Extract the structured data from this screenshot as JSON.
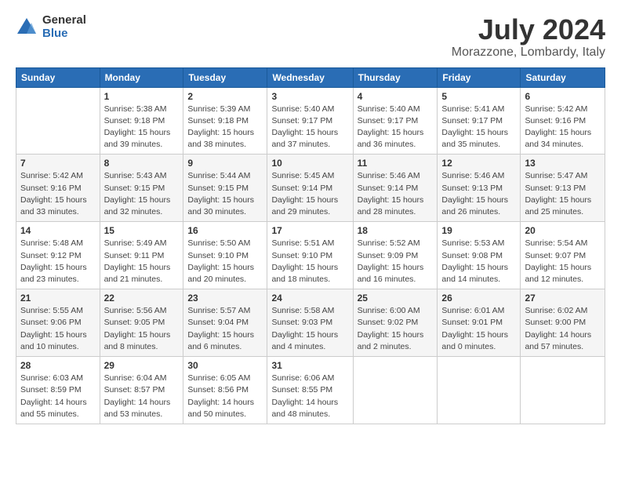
{
  "logo": {
    "general": "General",
    "blue": "Blue"
  },
  "title": "July 2024",
  "subtitle": "Morazzone, Lombardy, Italy",
  "headers": [
    "Sunday",
    "Monday",
    "Tuesday",
    "Wednesday",
    "Thursday",
    "Friday",
    "Saturday"
  ],
  "weeks": [
    [
      {
        "day": "",
        "info": ""
      },
      {
        "day": "1",
        "info": "Sunrise: 5:38 AM\nSunset: 9:18 PM\nDaylight: 15 hours\nand 39 minutes."
      },
      {
        "day": "2",
        "info": "Sunrise: 5:39 AM\nSunset: 9:18 PM\nDaylight: 15 hours\nand 38 minutes."
      },
      {
        "day": "3",
        "info": "Sunrise: 5:40 AM\nSunset: 9:17 PM\nDaylight: 15 hours\nand 37 minutes."
      },
      {
        "day": "4",
        "info": "Sunrise: 5:40 AM\nSunset: 9:17 PM\nDaylight: 15 hours\nand 36 minutes."
      },
      {
        "day": "5",
        "info": "Sunrise: 5:41 AM\nSunset: 9:17 PM\nDaylight: 15 hours\nand 35 minutes."
      },
      {
        "day": "6",
        "info": "Sunrise: 5:42 AM\nSunset: 9:16 PM\nDaylight: 15 hours\nand 34 minutes."
      }
    ],
    [
      {
        "day": "7",
        "info": "Sunrise: 5:42 AM\nSunset: 9:16 PM\nDaylight: 15 hours\nand 33 minutes."
      },
      {
        "day": "8",
        "info": "Sunrise: 5:43 AM\nSunset: 9:15 PM\nDaylight: 15 hours\nand 32 minutes."
      },
      {
        "day": "9",
        "info": "Sunrise: 5:44 AM\nSunset: 9:15 PM\nDaylight: 15 hours\nand 30 minutes."
      },
      {
        "day": "10",
        "info": "Sunrise: 5:45 AM\nSunset: 9:14 PM\nDaylight: 15 hours\nand 29 minutes."
      },
      {
        "day": "11",
        "info": "Sunrise: 5:46 AM\nSunset: 9:14 PM\nDaylight: 15 hours\nand 28 minutes."
      },
      {
        "day": "12",
        "info": "Sunrise: 5:46 AM\nSunset: 9:13 PM\nDaylight: 15 hours\nand 26 minutes."
      },
      {
        "day": "13",
        "info": "Sunrise: 5:47 AM\nSunset: 9:13 PM\nDaylight: 15 hours\nand 25 minutes."
      }
    ],
    [
      {
        "day": "14",
        "info": "Sunrise: 5:48 AM\nSunset: 9:12 PM\nDaylight: 15 hours\nand 23 minutes."
      },
      {
        "day": "15",
        "info": "Sunrise: 5:49 AM\nSunset: 9:11 PM\nDaylight: 15 hours\nand 21 minutes."
      },
      {
        "day": "16",
        "info": "Sunrise: 5:50 AM\nSunset: 9:10 PM\nDaylight: 15 hours\nand 20 minutes."
      },
      {
        "day": "17",
        "info": "Sunrise: 5:51 AM\nSunset: 9:10 PM\nDaylight: 15 hours\nand 18 minutes."
      },
      {
        "day": "18",
        "info": "Sunrise: 5:52 AM\nSunset: 9:09 PM\nDaylight: 15 hours\nand 16 minutes."
      },
      {
        "day": "19",
        "info": "Sunrise: 5:53 AM\nSunset: 9:08 PM\nDaylight: 15 hours\nand 14 minutes."
      },
      {
        "day": "20",
        "info": "Sunrise: 5:54 AM\nSunset: 9:07 PM\nDaylight: 15 hours\nand 12 minutes."
      }
    ],
    [
      {
        "day": "21",
        "info": "Sunrise: 5:55 AM\nSunset: 9:06 PM\nDaylight: 15 hours\nand 10 minutes."
      },
      {
        "day": "22",
        "info": "Sunrise: 5:56 AM\nSunset: 9:05 PM\nDaylight: 15 hours\nand 8 minutes."
      },
      {
        "day": "23",
        "info": "Sunrise: 5:57 AM\nSunset: 9:04 PM\nDaylight: 15 hours\nand 6 minutes."
      },
      {
        "day": "24",
        "info": "Sunrise: 5:58 AM\nSunset: 9:03 PM\nDaylight: 15 hours\nand 4 minutes."
      },
      {
        "day": "25",
        "info": "Sunrise: 6:00 AM\nSunset: 9:02 PM\nDaylight: 15 hours\nand 2 minutes."
      },
      {
        "day": "26",
        "info": "Sunrise: 6:01 AM\nSunset: 9:01 PM\nDaylight: 15 hours\nand 0 minutes."
      },
      {
        "day": "27",
        "info": "Sunrise: 6:02 AM\nSunset: 9:00 PM\nDaylight: 14 hours\nand 57 minutes."
      }
    ],
    [
      {
        "day": "28",
        "info": "Sunrise: 6:03 AM\nSunset: 8:59 PM\nDaylight: 14 hours\nand 55 minutes."
      },
      {
        "day": "29",
        "info": "Sunrise: 6:04 AM\nSunset: 8:57 PM\nDaylight: 14 hours\nand 53 minutes."
      },
      {
        "day": "30",
        "info": "Sunrise: 6:05 AM\nSunset: 8:56 PM\nDaylight: 14 hours\nand 50 minutes."
      },
      {
        "day": "31",
        "info": "Sunrise: 6:06 AM\nSunset: 8:55 PM\nDaylight: 14 hours\nand 48 minutes."
      },
      {
        "day": "",
        "info": ""
      },
      {
        "day": "",
        "info": ""
      },
      {
        "day": "",
        "info": ""
      }
    ]
  ]
}
